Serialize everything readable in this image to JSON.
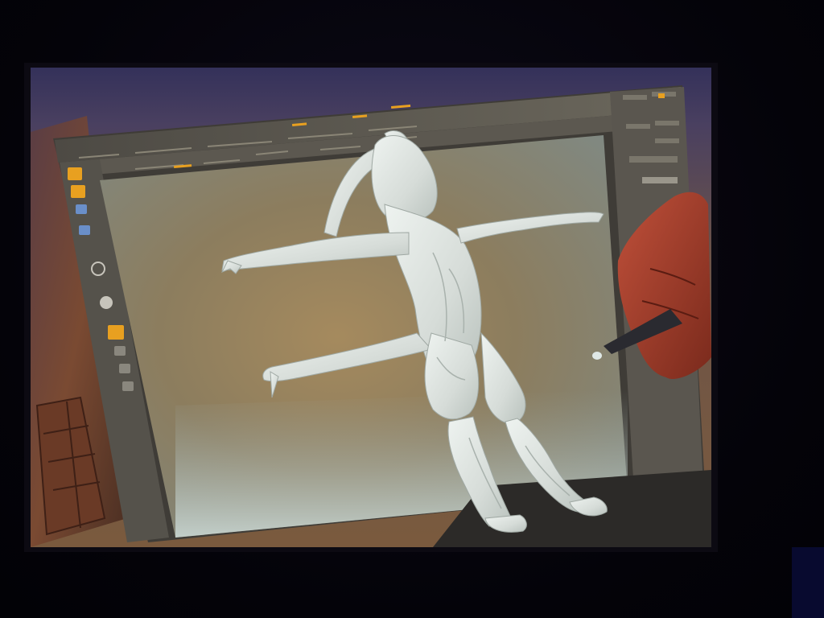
{
  "scene": {
    "description_hidden": false,
    "colors": {
      "room_background": "#05040d",
      "screen_top": "#34315a",
      "desk_wood": "#7a4a32",
      "app_chrome": "#57534b",
      "viewport_bg": "#8a8064",
      "sculpt_model": "#d9e0dc",
      "accent_orange": "#e8a020"
    },
    "icons": [
      "brush-icon",
      "material-sphere-icon",
      "stroke-icon",
      "alpha-icon",
      "stylus-pen-icon"
    ]
  }
}
